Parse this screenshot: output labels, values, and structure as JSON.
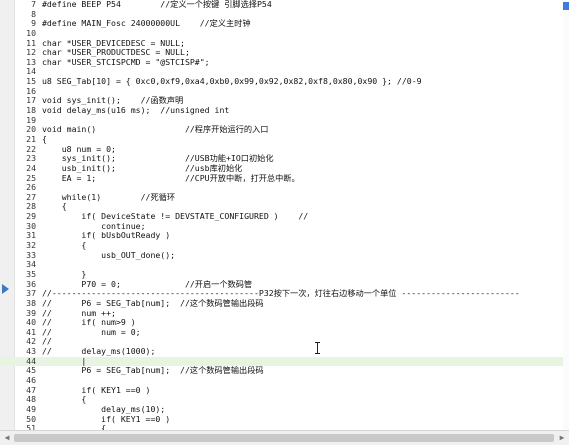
{
  "editor": {
    "lines": [
      {
        "n": "7",
        "text": "#define BEEP P54        //定义一个按键 引脚选择P54"
      },
      {
        "n": "8",
        "text": ""
      },
      {
        "n": "9",
        "text": "#define MAIN_Fosc 24000000UL    //定义主时钟"
      },
      {
        "n": "10",
        "text": ""
      },
      {
        "n": "11",
        "text": "char *USER_DEVICEDESC = NULL;"
      },
      {
        "n": "12",
        "text": "char *USER_PRODUCTDESC = NULL;"
      },
      {
        "n": "13",
        "text": "char *USER_STCISPCMD = \"@STCISP#\";"
      },
      {
        "n": "14",
        "text": ""
      },
      {
        "n": "15",
        "text": "u8 SEG_Tab[10] = { 0xc0,0xf9,0xa4,0xb0,0x99,0x92,0x82,0xf8,0x80,0x90 }; //0-9"
      },
      {
        "n": "16",
        "text": ""
      },
      {
        "n": "17",
        "text": "void sys_init();    //函数声明"
      },
      {
        "n": "18",
        "text": "void delay_ms(u16 ms);  //unsigned int"
      },
      {
        "n": "19",
        "text": ""
      },
      {
        "n": "20",
        "text": "void main()                  //程序开始运行的入口"
      },
      {
        "n": "21",
        "text": "{"
      },
      {
        "n": "22",
        "text": "    u8 num = 0;"
      },
      {
        "n": "23",
        "text": "    sys_init();              //USB功能+IO口初始化"
      },
      {
        "n": "24",
        "text": "    usb_init();              //usb库初始化"
      },
      {
        "n": "25",
        "text": "    EA = 1;                  //CPU开放中断，打开总中断。"
      },
      {
        "n": "26",
        "text": ""
      },
      {
        "n": "27",
        "text": "    while(1)        //死循环"
      },
      {
        "n": "28",
        "text": "    {"
      },
      {
        "n": "29",
        "text": "        if( DeviceState != DEVSTATE_CONFIGURED )    //"
      },
      {
        "n": "30",
        "text": "            continue;"
      },
      {
        "n": "31",
        "text": "        if( bUsbOutReady )"
      },
      {
        "n": "32",
        "text": "        {"
      },
      {
        "n": "33",
        "text": "            usb_OUT_done();"
      },
      {
        "n": "34",
        "text": ""
      },
      {
        "n": "35",
        "text": "        }"
      },
      {
        "n": "36",
        "text": "        P70 = 0;             //开启一个数码管"
      },
      {
        "n": "37",
        "text": "//------------------------------------------P32按下一次，灯往右边移动一个单位 ------------------------"
      },
      {
        "n": "38",
        "text": "//      P6 = SEG_Tab[num];  //这个数码管输出段码"
      },
      {
        "n": "39",
        "text": "//      num ++;"
      },
      {
        "n": "40",
        "text": "//      if( num>9 )"
      },
      {
        "n": "41",
        "text": "//          num = 0;"
      },
      {
        "n": "42",
        "text": "//"
      },
      {
        "n": "43",
        "text": "//      delay_ms(1000);"
      },
      {
        "n": "44",
        "text": "        |"
      },
      {
        "n": "45",
        "text": "        P6 = SEG_Tab[num];  //这个数码管输出段码"
      },
      {
        "n": "46",
        "text": ""
      },
      {
        "n": "47",
        "text": "        if( KEY1 ==0 )"
      },
      {
        "n": "48",
        "text": "        {"
      },
      {
        "n": "49",
        "text": "            delay_ms(10);"
      },
      {
        "n": "50",
        "text": "            if( KEY1 ==0 )"
      },
      {
        "n": "51",
        "text": "            {"
      },
      {
        "n": "52",
        "text": "                BEEP = 0;"
      },
      {
        "n": "53",
        "text": ""
      }
    ],
    "current_line_index": 37,
    "marker_line": "37"
  },
  "colors": {
    "current_line": "#e7f4e2",
    "marker": "#3c78c8",
    "scroll_mark": "#3d7bd8"
  },
  "icons": {
    "execution_marker": "arrow-marker-icon",
    "text_cursor": "ibeam-cursor-icon",
    "scroll_left": "arrow-left-icon",
    "scroll_right": "arrow-right-icon"
  }
}
